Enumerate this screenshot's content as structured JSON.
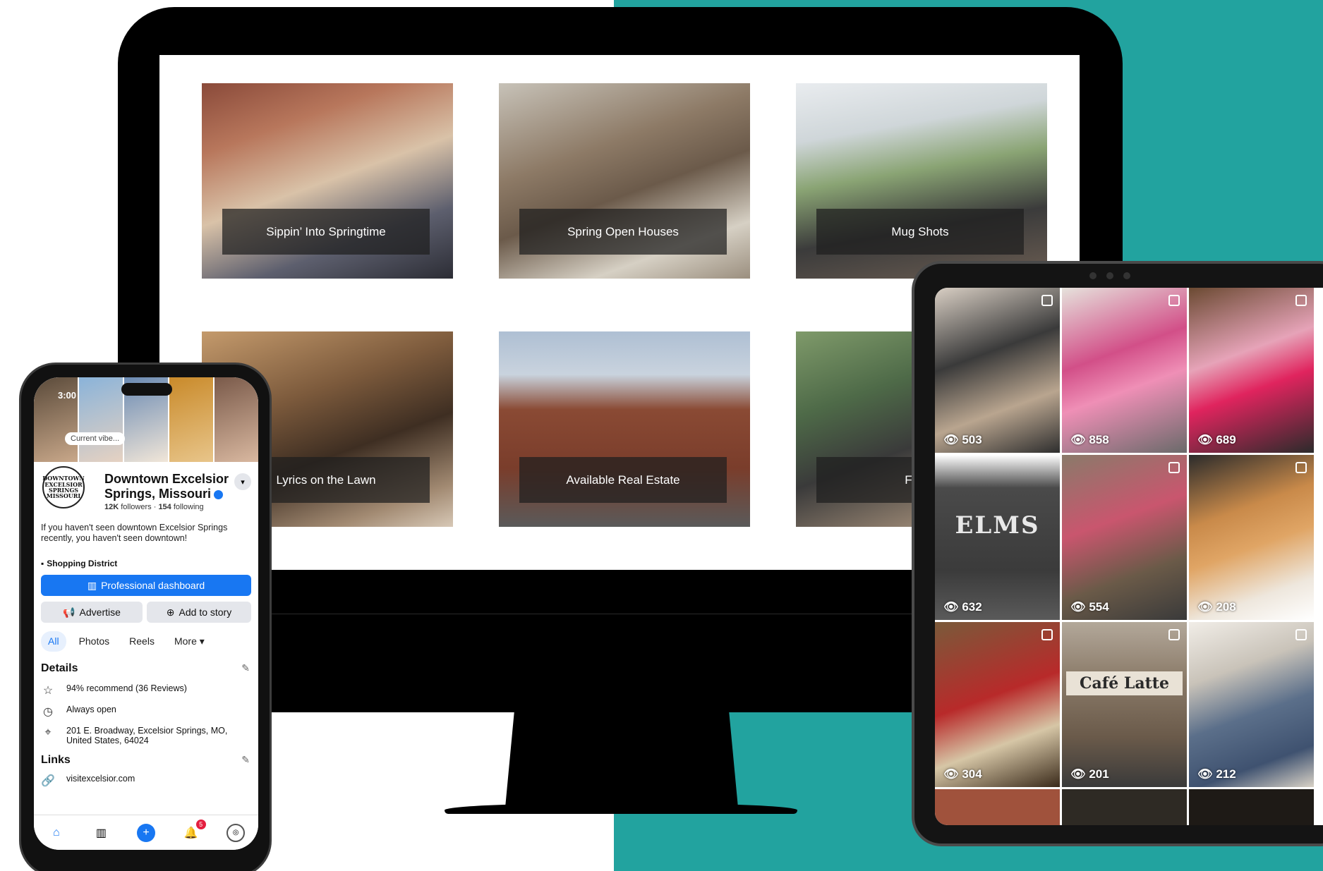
{
  "website": {
    "tiles": [
      {
        "caption": "Sippin’ Into Springtime"
      },
      {
        "caption": "Spring Open Houses"
      },
      {
        "caption": "Mug Shots"
      },
      {
        "caption": "Lyrics on the Lawn"
      },
      {
        "caption": "Available Real Estate"
      },
      {
        "caption": "Featu"
      }
    ]
  },
  "instagram": {
    "views": [
      "503",
      "858",
      "689",
      "632",
      "554",
      "208",
      "304",
      "201",
      "212"
    ]
  },
  "facebook": {
    "status_time": "3:00",
    "cover_chip": "Current vibe...",
    "logo_text": "DOWNTOWN EXCELSIOR SPRINGS MISSOURI",
    "page_name": "Downtown Excelsior Springs, Missouri",
    "followers": "12K",
    "followers_label": "followers",
    "following": "154",
    "following_label": "following",
    "bio": "If you haven't seen downtown Excelsior Springs recently, you haven't seen downtown!",
    "category": "Shopping District",
    "professional_dashboard": "Professional dashboard",
    "advertise": "Advertise",
    "add_to_story": "Add to story",
    "tabs": [
      "All",
      "Photos",
      "Reels",
      "More ▾"
    ],
    "details_heading": "Details",
    "details": [
      {
        "icon": "star-icon",
        "text": "94% recommend (36 Reviews)"
      },
      {
        "icon": "clock-icon",
        "text": "Always open"
      },
      {
        "icon": "location-pin-icon",
        "text": "201 E. Broadway, Excelsior Springs, MO, United States, 64024"
      }
    ],
    "links_heading": "Links",
    "link": "visitexcelsior.com",
    "notifications_badge": "5"
  },
  "colors": {
    "teal": "#22a39f",
    "fb_blue": "#1877f2"
  }
}
